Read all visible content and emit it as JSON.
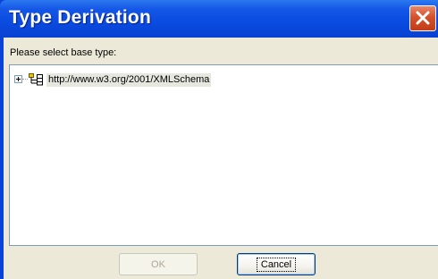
{
  "window": {
    "title": "Type Derivation"
  },
  "dialog": {
    "prompt": "Please select base type:",
    "tree": {
      "items": [
        {
          "label": "http://www.w3.org/2001/XMLSchema",
          "expanded": false,
          "icon": "schema-tree-icon",
          "expander_icon": "plus-expander-icon"
        }
      ]
    },
    "buttons": {
      "ok_label": "OK",
      "ok_enabled": false,
      "cancel_label": "Cancel"
    }
  },
  "colors": {
    "titlebar_blue": "#0a4be0",
    "close_red": "#d5512a",
    "client_bg": "#ece9d8",
    "tree_border": "#7f9db9",
    "icon_yellow": "#e8c800"
  }
}
